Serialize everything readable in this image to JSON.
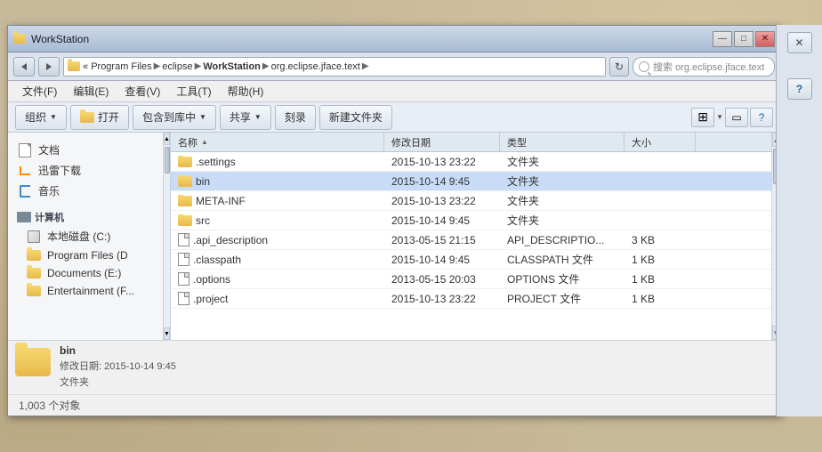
{
  "window": {
    "title": "WorkStation",
    "min_btn": "—",
    "max_btn": "□",
    "close_btn": "✕"
  },
  "address_bar": {
    "path_parts": [
      "Program Files",
      "eclipse",
      "WorkStation",
      "org.eclipse.jface.text"
    ],
    "search_placeholder": "搜索 org.eclipse.jface.text",
    "refresh_symbol": "↻"
  },
  "menu": {
    "items": [
      {
        "label": "文件(F)",
        "underline_index": 2
      },
      {
        "label": "编辑(E)",
        "underline_index": 2
      },
      {
        "label": "查看(V)",
        "underline_index": 2
      },
      {
        "label": "工具(T)",
        "underline_index": 2
      },
      {
        "label": "帮助(H)",
        "underline_index": 2
      }
    ]
  },
  "toolbar": {
    "organize_label": "组织",
    "open_label": "打开",
    "include_label": "包含到库中",
    "share_label": "共享",
    "burn_label": "刻录",
    "new_folder_label": "新建文件夹",
    "dropdown_symbol": "▼"
  },
  "sidebar": {
    "items": [
      {
        "label": "文档",
        "icon": "doc"
      },
      {
        "label": "迅雷下载",
        "icon": "download"
      },
      {
        "label": "音乐",
        "icon": "music"
      },
      {
        "label": "计算机",
        "icon": "computer",
        "section_header": true
      },
      {
        "label": "本地磁盘 (C:)",
        "icon": "disk"
      },
      {
        "label": "Program Files (D",
        "icon": "folder"
      },
      {
        "label": "Documents (E:)",
        "icon": "folder"
      },
      {
        "label": "Entertainment (F...",
        "icon": "folder"
      }
    ]
  },
  "file_list": {
    "columns": [
      {
        "label": "名称",
        "sort_arrow": "▲"
      },
      {
        "label": "修改日期"
      },
      {
        "label": "类型"
      },
      {
        "label": "大小"
      }
    ],
    "rows": [
      {
        "name": ".settings",
        "date": "2015-10-13 23:22",
        "type": "文件夹",
        "size": "",
        "icon": "folder",
        "selected": false
      },
      {
        "name": "bin",
        "date": "2015-10-14 9:45",
        "type": "文件夹",
        "size": "",
        "icon": "folder",
        "selected": true
      },
      {
        "name": "META-INF",
        "date": "2015-10-13 23:22",
        "type": "文件夹",
        "size": "",
        "icon": "folder",
        "selected": false
      },
      {
        "name": "src",
        "date": "2015-10-14 9:45",
        "type": "文件夹",
        "size": "",
        "icon": "folder",
        "selected": false
      },
      {
        "name": ".api_description",
        "date": "2013-05-15 21:15",
        "type": "API_DESCRIPTIO...",
        "size": "3 KB",
        "icon": "doc",
        "selected": false
      },
      {
        "name": ".classpath",
        "date": "2015-10-14 9:45",
        "type": "CLASSPATH 文件",
        "size": "1 KB",
        "icon": "doc",
        "selected": false
      },
      {
        "name": ".options",
        "date": "2013-05-15 20:03",
        "type": "OPTIONS 文件",
        "size": "1 KB",
        "icon": "doc",
        "selected": false
      },
      {
        "name": ".project",
        "date": "2015-10-13 23:22",
        "type": "PROJECT 文件",
        "size": "1 KB",
        "icon": "doc",
        "selected": false
      }
    ]
  },
  "status": {
    "selected_name": "bin",
    "selected_meta_date": "修改日期: 2015-10-14 9:45",
    "selected_meta_type": "文件夹",
    "count_label": "1,003 个对象"
  },
  "side_panel": {
    "items": [
      {
        "symbol": "✕",
        "label": "close-icon"
      },
      {
        "symbol": "?",
        "label": "help-icon"
      }
    ]
  }
}
